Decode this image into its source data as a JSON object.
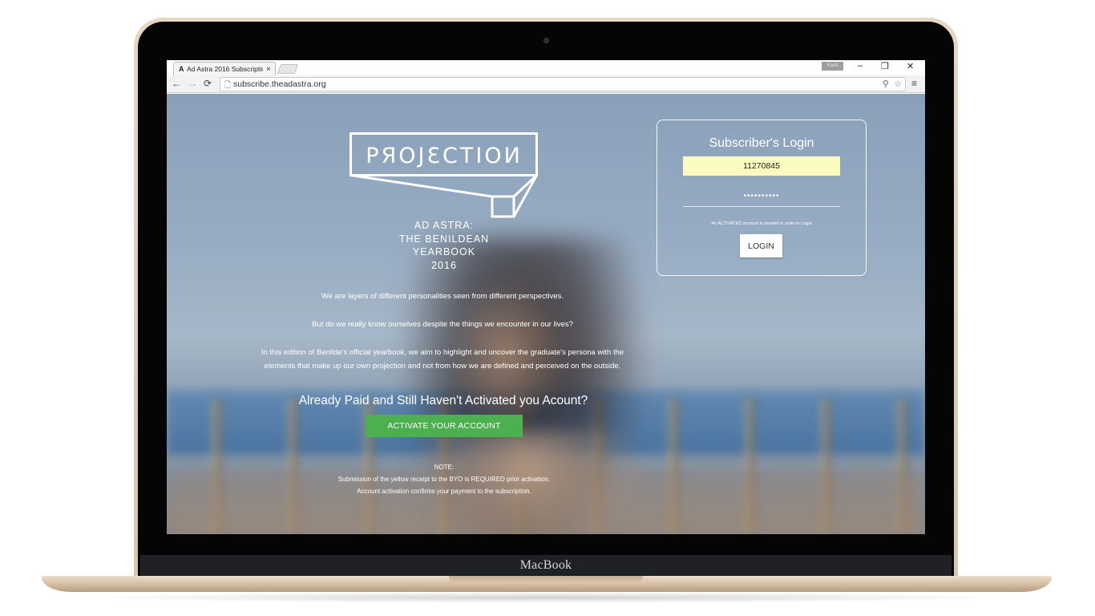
{
  "device": {
    "brand": "MacBook"
  },
  "browser": {
    "tab_title": "Ad Astra 2016 Subscriptio",
    "tab_favicon": "A",
    "tab_close": "×",
    "profile_label": "Kash",
    "url": "subscribe.theadastra.org",
    "window_controls": {
      "minimize": "–",
      "restore": "❐",
      "close": "✕"
    },
    "nav": {
      "back": "←",
      "forward": "→",
      "reload": "⟳"
    },
    "url_icons": {
      "page": "🗋",
      "zoom": "⚲",
      "star": "☆"
    },
    "menu": "≡"
  },
  "hero": {
    "logo_word": "PЯOJƐCTIOИ",
    "subtitle_lines": [
      "AD ASTRA:",
      "THE BENILDEAN",
      "YEARBOOK",
      "2016"
    ],
    "intro": [
      "We are layers of different personalities seen from different perspectives.",
      "But do we really know ourselves despite the things we encounter in our lives?",
      "In this edition of Benilde's official yearbook, we aim to highlight and uncover the graduate's persona with the",
      "elements that make up our own projection and not from how we are defined and perceived on the outside."
    ],
    "cta_heading": "Already Paid and Still Haven't Activated you Acount?",
    "activate_label": "ACTIVATE YOUR ACCOUNT",
    "note": [
      "NOTE:",
      "Submission of the yellow receipt to the BYO is REQUIRED prior activation.",
      "Account activation confirms your payment to the subscription."
    ]
  },
  "login": {
    "title": "Subscriber's Login",
    "username_value": "11270845",
    "password_mask": "••••••••••",
    "notice": "An ACTIVATED account is needed in order to Login",
    "button_label": "LOGIN"
  }
}
